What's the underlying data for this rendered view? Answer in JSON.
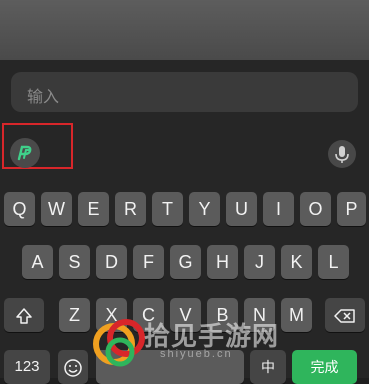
{
  "search": {
    "placeholder": "输入"
  },
  "toolbar": {
    "logo_icon": "pp-logo-icon",
    "mic_icon": "microphone-icon"
  },
  "rows": {
    "row1": [
      "Q",
      "W",
      "E",
      "R",
      "T",
      "Y",
      "U",
      "I",
      "O",
      "P"
    ],
    "row2": [
      "A",
      "S",
      "D",
      "F",
      "G",
      "H",
      "J",
      "K",
      "L"
    ],
    "row3": [
      "Z",
      "X",
      "C",
      "V",
      "B",
      "N",
      "M"
    ]
  },
  "bottom": {
    "numbers_label": "123",
    "emoji_icon": "emoji-icon",
    "lang_label": "中",
    "done_label": "完成"
  },
  "watermark": {
    "text": "拾见手游网",
    "url": "shiyueb.cn"
  },
  "colors": {
    "accent": "#2fb55c",
    "highlight": "#d8262a"
  }
}
